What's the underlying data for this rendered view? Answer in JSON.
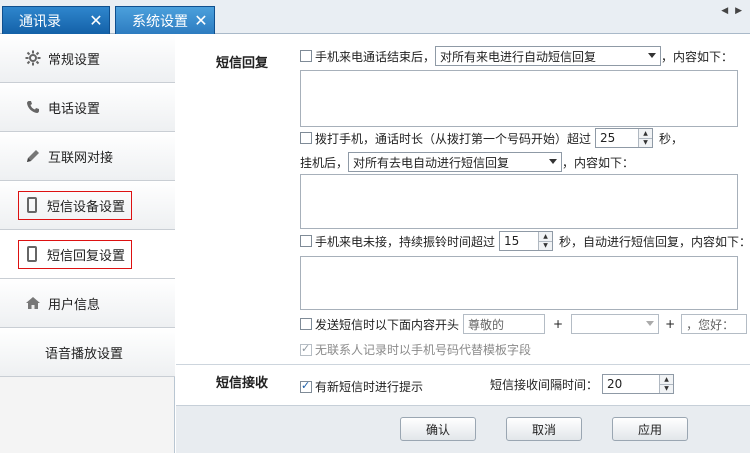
{
  "tabs": [
    {
      "label": "通讯录",
      "close": "✕"
    },
    {
      "label": "系统设置",
      "close": "✕"
    }
  ],
  "tab_scroll": "◀ ▶",
  "sidebar": {
    "items": [
      {
        "label": "常规设置",
        "icon": "gear-icon"
      },
      {
        "label": "电话设置",
        "icon": "phone-handset-icon"
      },
      {
        "label": "互联网对接",
        "icon": "pencil-icon"
      },
      {
        "label": "短信设备设置",
        "icon": "mobile-phone-icon"
      },
      {
        "label": "短信回复设置",
        "icon": "mobile-phone-icon"
      },
      {
        "label": "用户信息",
        "icon": "home-icon"
      },
      {
        "label": "语音播放设置",
        "icon": ""
      }
    ],
    "active_index": 4
  },
  "reply": {
    "section_label": "短信回复",
    "after_call": {
      "checked": false,
      "label": "手机来电通话结束后，",
      "select_value": "对所有来电进行自动短信回复",
      "suffix": "，内容如下："
    },
    "outgoing": {
      "checked": false,
      "label": "拨打手机，通话时长（从拨打第一个号码开始）超过",
      "seconds": "25",
      "unit": "秒，",
      "hangup_prefix": "挂机后，",
      "select_value": "对所有去电自动进行短信回复",
      "suffix": "，内容如下："
    },
    "missed": {
      "checked": false,
      "label": "手机来电未接，持续振铃时间超过",
      "seconds": "15",
      "suffix": "秒，自动进行短信回复，内容如下："
    },
    "prefix_option": {
      "checked": false,
      "label": "发送短信时以下面内容开头",
      "field1": "尊敬的",
      "plus": "+",
      "field3": "，您好："
    },
    "template_option": {
      "checked": true,
      "label": "无联系人记录时以手机号码代替模板字段"
    }
  },
  "receive": {
    "section_label": "短信接收",
    "notify": {
      "checked": true,
      "label": "有新短信时进行提示"
    },
    "interval_label": "短信接收间隔时间：",
    "interval_value": "20"
  },
  "buttons": {
    "confirm": "确认",
    "cancel": "取消",
    "apply": "应用"
  },
  "colors": {
    "tab_blue": "#1e6fb8",
    "highlight_red": "#dd1111"
  }
}
